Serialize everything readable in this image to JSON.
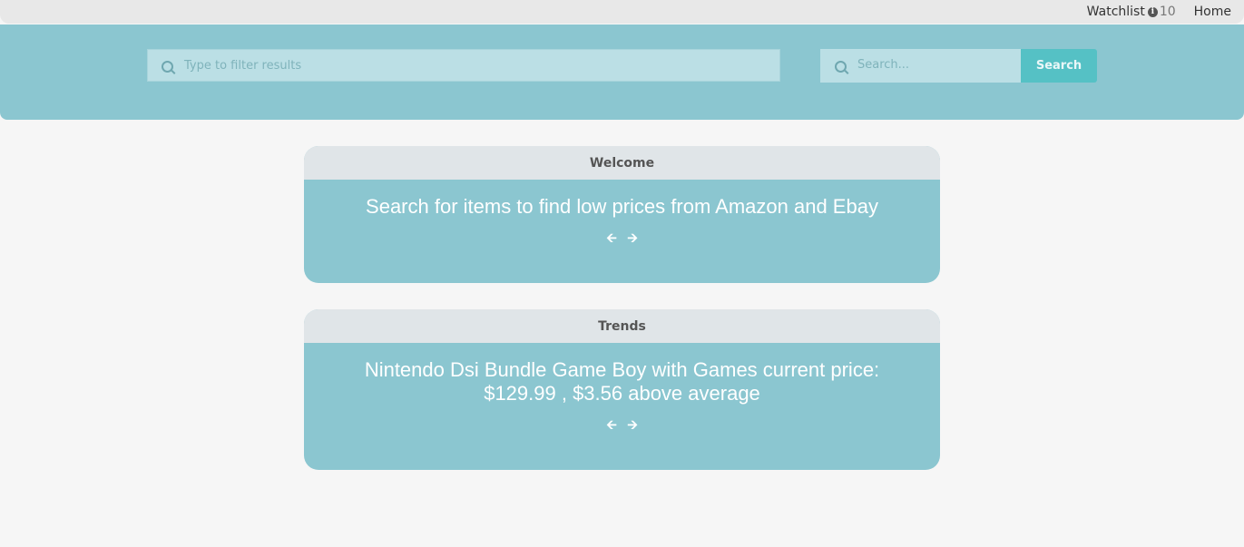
{
  "nav": {
    "watchlist_label": "Watchlist",
    "watchlist_count": "10",
    "home_label": "Home"
  },
  "filter": {
    "placeholder": "Type to filter results"
  },
  "search": {
    "placeholder": "Search...",
    "button_label": "Search"
  },
  "cards": [
    {
      "header": "Welcome",
      "text": "Search for items to find low prices from Amazon and Ebay"
    },
    {
      "header": "Trends",
      "text": "Nintendo Dsi Bundle Game Boy with Games current price: $129.99 , $3.56 above average"
    }
  ],
  "icons": {
    "prev": "arrow-left-icon",
    "next": "arrow-right-icon",
    "info": "info-icon",
    "search": "search-icon"
  },
  "colors": {
    "banner": "#8bc6d0",
    "accent_button": "#55c1c5",
    "card_header": "#e0e5e8"
  }
}
